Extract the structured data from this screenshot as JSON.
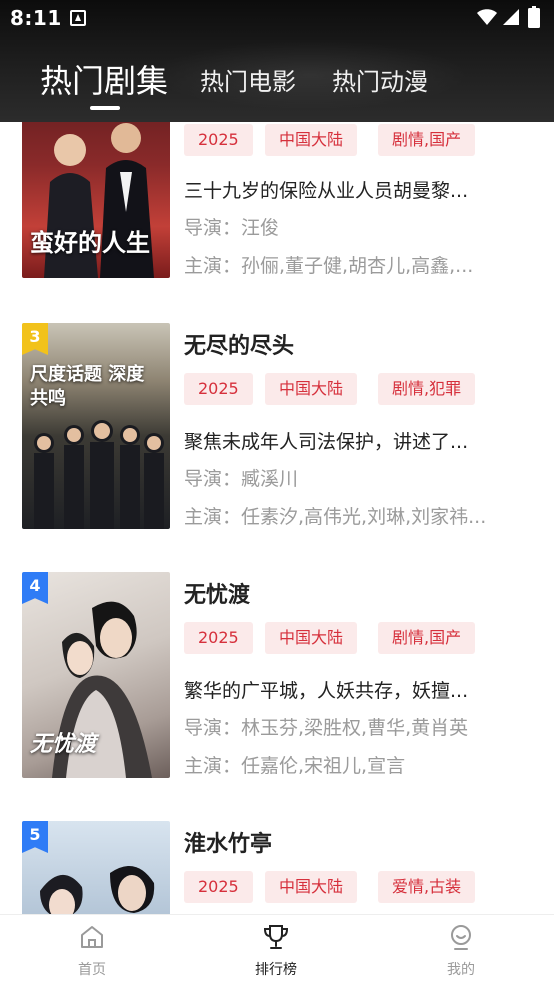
{
  "status_bar": {
    "time": "8:11"
  },
  "tabs": [
    {
      "label": "热门剧集"
    },
    {
      "label": "热门电影"
    },
    {
      "label": "热门动漫"
    }
  ],
  "items": [
    {
      "poster_title": "蛮好的人生",
      "tags": [
        "2025",
        "中国大陆",
        "剧情,国产"
      ],
      "desc": "三十九岁的保险从业人员胡曼黎...",
      "director": "导演：汪俊",
      "cast": "主演：孙俪,董子健,胡杏儿,高鑫,..."
    },
    {
      "rank": "3",
      "title": "无尽的尽头",
      "poster_title": "尺度话题 深度共鸣",
      "tags": [
        "2025",
        "中国大陆",
        "剧情,犯罪"
      ],
      "desc": "聚焦未成年人司法保护，讲述了...",
      "director": "导演：臧溪川",
      "cast": "主演：任素汐,高伟光,刘琳,刘家祎..."
    },
    {
      "rank": "4",
      "title": "无忧渡",
      "poster_title": "无忧渡",
      "tags": [
        "2025",
        "中国大陆",
        "剧情,国产"
      ],
      "desc": "繁华的广平城，人妖共存，妖擅...",
      "director": "导演：林玉芬,梁胜权,曹华,黄肖英",
      "cast": "主演：任嘉伦,宋祖儿,宣言"
    },
    {
      "rank": "5",
      "title": "淮水竹亭",
      "tags": [
        "2025",
        "中国大陆",
        "爱情,古装"
      ]
    }
  ],
  "bottom_nav": [
    {
      "label": "首页",
      "icon": "home-icon"
    },
    {
      "label": "排行榜",
      "icon": "trophy-icon"
    },
    {
      "label": "我的",
      "icon": "profile-icon"
    }
  ],
  "colors": {
    "accent_red": "#d6303c",
    "tag_bg": "#fbeaea",
    "rank3_badge": "#f2c21b",
    "rank4_badge": "#2f7cf6",
    "rank5_badge": "#2f7cf6"
  }
}
